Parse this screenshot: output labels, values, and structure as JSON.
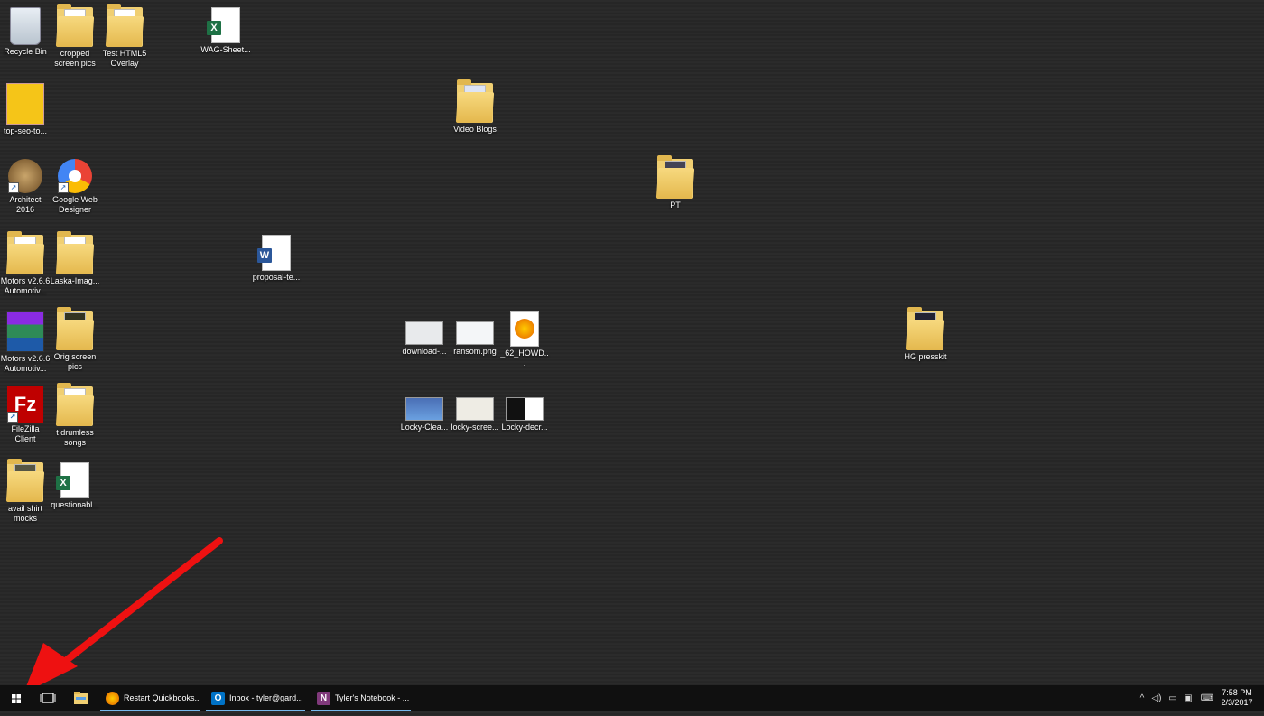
{
  "desktop": {
    "icons": {
      "recycle": "Recycle Bin",
      "cropped": "cropped screen pics",
      "testhtml": "Test HTML5 Overlay",
      "wag": "WAG-Sheet...",
      "seo": "top-seo-to...",
      "videoblogs": "Video Blogs",
      "architect": "Architect 2016",
      "gwd": "Google Web Designer",
      "pt": "PT",
      "motors1": "Motors v2.6.6 Automotiv...",
      "laska": "Laska-Imag...",
      "proposal": "proposal-te...",
      "motors2": "Motors v2.6.6 Automotiv...",
      "orig": "Orig screen pics",
      "download": "download-...",
      "ransom": "ransom.png",
      "howd": "_62_HOWD...",
      "hgpress": "HG presskit",
      "filezilla": "FileZilla Client",
      "drumless": "t drumless songs",
      "lockyclea": "Locky-Clea...",
      "lockyscree": "locky-scree...",
      "lockydecr": "Locky-decr...",
      "availshirt": "avail shirt mocks",
      "questionable": "questionabl..."
    }
  },
  "taskbar": {
    "apps": [
      {
        "label": "Restart Quickbooks...",
        "color": "#e66000"
      },
      {
        "label": "Inbox - tyler@gard...",
        "color": "#0072c6"
      },
      {
        "label": "Tyler's Notebook - ...",
        "color": "#80397b"
      }
    ],
    "clock_time": "7:58 PM",
    "clock_date": "2/3/2017"
  },
  "colors": {
    "arrow": "#ee1111",
    "taskbar": "#101010",
    "accent": "#76b9ed"
  }
}
